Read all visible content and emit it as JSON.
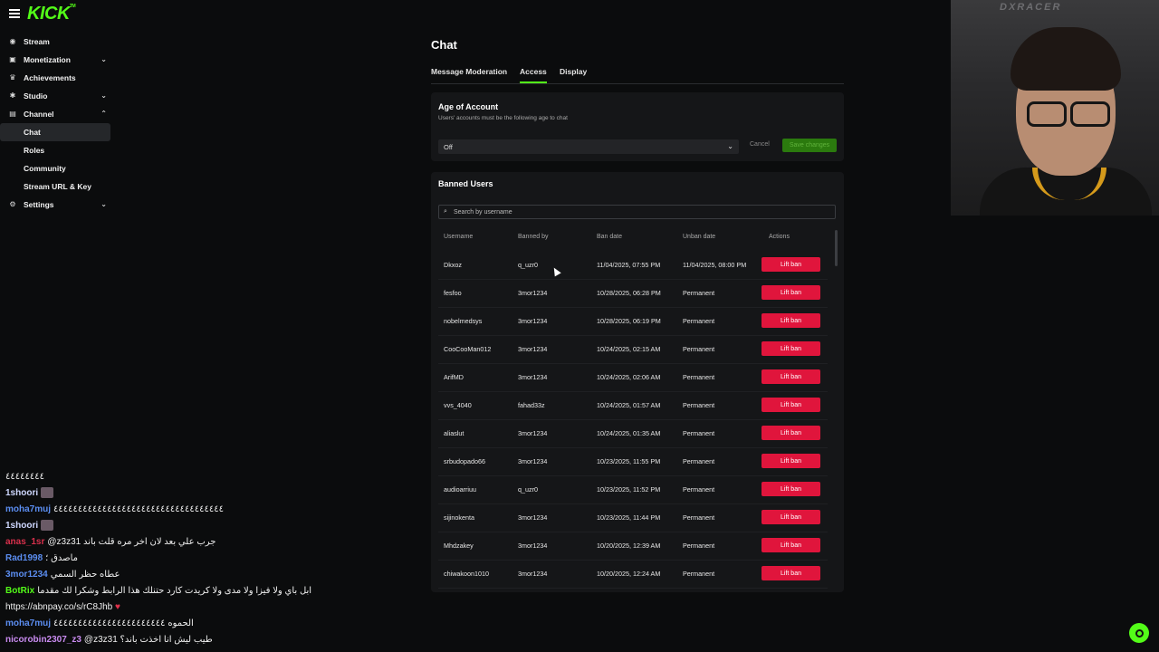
{
  "app": {
    "logo_text": "KICK",
    "logo_mark": "TM"
  },
  "sidebar": {
    "items": [
      {
        "label": "Stream",
        "icon": "broadcast-icon"
      },
      {
        "label": "Monetization",
        "icon": "dollar-icon"
      },
      {
        "label": "Achievements",
        "icon": "trophy-icon"
      },
      {
        "label": "Studio",
        "icon": "studio-icon"
      },
      {
        "label": "Channel",
        "icon": "channel-icon"
      },
      {
        "label": "Chat"
      },
      {
        "label": "Roles"
      },
      {
        "label": "Community"
      },
      {
        "label": "Stream URL & Key"
      },
      {
        "label": "Settings",
        "icon": "gear-icon"
      }
    ]
  },
  "page": {
    "title": "Chat",
    "tabs": [
      "Message Moderation",
      "Access",
      "Display"
    ],
    "active_tab": "Access"
  },
  "age": {
    "title": "Age of Account",
    "subtitle": "Users' accounts must be the following age to chat",
    "select_value": "Off",
    "cancel": "Cancel",
    "save": "Save changes"
  },
  "banned": {
    "title": "Banned Users",
    "search_placeholder": "Search by username",
    "headers": [
      "Username",
      "Banned by",
      "Ban date",
      "Unban date",
      "Actions"
    ],
    "action_label": "Lift ban",
    "rows": [
      {
        "user": "Dkxoz",
        "by": "q_uzr0",
        "ban": "11/04/2025, 07:55 PM",
        "unban": "11/04/2025, 08:00 PM"
      },
      {
        "user": "fesfoo",
        "by": "3mor1234",
        "ban": "10/28/2025, 06:28 PM",
        "unban": "Permanent"
      },
      {
        "user": "nobelmedsys",
        "by": "3mor1234",
        "ban": "10/28/2025, 06:19 PM",
        "unban": "Permanent"
      },
      {
        "user": "CooCooMan012",
        "by": "3mor1234",
        "ban": "10/24/2025, 02:15 AM",
        "unban": "Permanent"
      },
      {
        "user": "ArifMD",
        "by": "3mor1234",
        "ban": "10/24/2025, 02:06 AM",
        "unban": "Permanent"
      },
      {
        "user": "vvs_4040",
        "by": "fahad33z",
        "ban": "10/24/2025, 01:57 AM",
        "unban": "Permanent"
      },
      {
        "user": "aliaslut",
        "by": "3mor1234",
        "ban": "10/24/2025, 01:35 AM",
        "unban": "Permanent"
      },
      {
        "user": "srbudopado66",
        "by": "3mor1234",
        "ban": "10/23/2025, 11:55 PM",
        "unban": "Permanent"
      },
      {
        "user": "audioarriuu",
        "by": "q_uzr0",
        "ban": "10/23/2025, 11:52 PM",
        "unban": "Permanent"
      },
      {
        "user": "sijinokenta",
        "by": "3mor1234",
        "ban": "10/23/2025, 11:44 PM",
        "unban": "Permanent"
      },
      {
        "user": "Mhdzakey",
        "by": "3mor1234",
        "ban": "10/20/2025, 12:39 AM",
        "unban": "Permanent"
      },
      {
        "user": "chiwakoon1010",
        "by": "3mor1234",
        "ban": "10/20/2025, 12:24 AM",
        "unban": "Permanent"
      }
    ]
  },
  "webcam": {
    "chair_text": "DXRACER"
  },
  "chat_overlay": [
    {
      "user": "",
      "color": "#ffffff",
      "msg": "٤٤٤٤٤٤٤٤"
    },
    {
      "user": "1shoori",
      "color": "#cfd8ff",
      "msg": "",
      "emote": true
    },
    {
      "user": "moha7muj",
      "color": "#5b8df0",
      "msg": "٤٤٤٤٤٤٤٤٤٤٤٤٤٤٤٤٤٤٤٤٤٤٤٤٤٤٤٤٤٤٤٤٤٤٤"
    },
    {
      "user": "1shoori",
      "color": "#cfd8ff",
      "msg": "",
      "emote": true
    },
    {
      "user": "anas_1sr",
      "color": "#d8304c",
      "msg": "@z3z31 جرب علي بعد لان اخر مره قلت باند"
    },
    {
      "user": "Rad1998",
      "color": "#5b8df0",
      "msg": "ماصدق ؛"
    },
    {
      "user": "3mor1234",
      "color": "#5b8df0",
      "msg": "عطاه حظر السمي"
    },
    {
      "user": "BotRix",
      "color": "#53fc18",
      "msg": "اذا تبي تدعم ابل باي ولا فيزا ولا مدى ولا كريدت كارد حتنلك هذا الرابط وشكرا لك مقدما"
    },
    {
      "user": "",
      "color": "#ffffff",
      "msg": "https://abnpay.co/s/rC8Jhb",
      "heart": true
    },
    {
      "user": "moha7muj",
      "color": "#5b8df0",
      "msg": "الحموه ٤٤٤٤٤٤٤٤٤٤٤٤٤٤٤٤٤٤٤٤٤٤٤"
    },
    {
      "user": "nicorobin2307_z3",
      "color": "#c98bf0",
      "msg": "@z3z31 طيب ليش انا اخذت باند؟"
    }
  ]
}
